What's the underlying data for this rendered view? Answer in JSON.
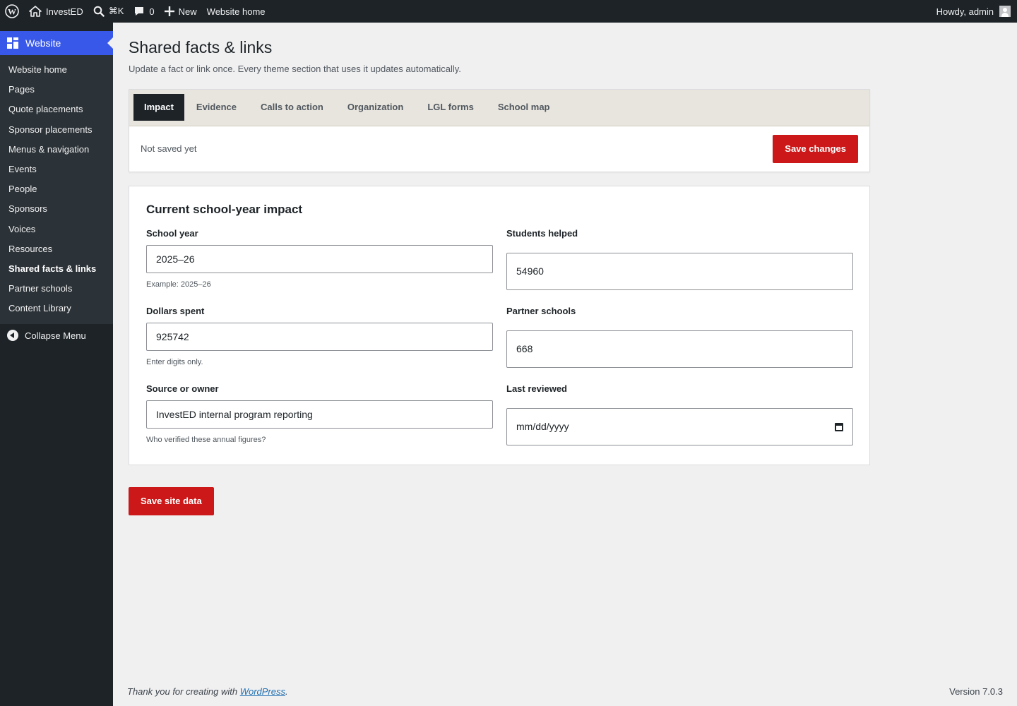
{
  "adminbar": {
    "site_name": "InvestED",
    "shortcut": "⌘K",
    "comments_count": "0",
    "new_label": "New",
    "website_home": "Website home",
    "greeting": "Howdy, admin"
  },
  "sidebar": {
    "section_label": "Website",
    "items": [
      {
        "label": "Website home"
      },
      {
        "label": "Pages"
      },
      {
        "label": "Quote placements"
      },
      {
        "label": "Sponsor placements"
      },
      {
        "label": "Menus & navigation"
      },
      {
        "label": "Events"
      },
      {
        "label": "People"
      },
      {
        "label": "Sponsors"
      },
      {
        "label": "Voices"
      },
      {
        "label": "Resources"
      },
      {
        "label": "Shared facts & links"
      },
      {
        "label": "Partner schools"
      },
      {
        "label": "Content Library"
      }
    ],
    "collapse_label": "Collapse Menu"
  },
  "page": {
    "title": "Shared facts & links",
    "description": "Update a fact or link once. Every theme section that uses it updates automatically."
  },
  "tabs": [
    {
      "label": "Impact"
    },
    {
      "label": "Evidence"
    },
    {
      "label": "Calls to action"
    },
    {
      "label": "Organization"
    },
    {
      "label": "LGL forms"
    },
    {
      "label": "School map"
    }
  ],
  "savebar": {
    "status": "Not saved yet",
    "save_label": "Save changes"
  },
  "impact": {
    "title": "Current school-year impact",
    "school_year": {
      "label": "School year",
      "value": "2025–26",
      "hint": "Example: 2025–26"
    },
    "students_helped": {
      "label": "Students helped",
      "value": "54960"
    },
    "dollars_spent": {
      "label": "Dollars spent",
      "value": "925742",
      "hint": "Enter digits only."
    },
    "partner_schools": {
      "label": "Partner schools",
      "value": "668"
    },
    "source_owner": {
      "label": "Source or owner",
      "value": "InvestED internal program reporting",
      "hint": "Who verified these annual figures?"
    },
    "last_reviewed": {
      "label": "Last reviewed",
      "placeholder": "mm/dd/yyyy"
    }
  },
  "save_site_label": "Save site data",
  "footer": {
    "thanks_prefix": "Thank you for creating with ",
    "wp_link": "WordPress",
    "thanks_suffix": ".",
    "version": "Version 7.0.3"
  },
  "colors": {
    "accent": "#3858e9",
    "save_red": "#cc1818",
    "admin_dark": "#1d2327",
    "tabbar_bg": "#e8e5de"
  }
}
